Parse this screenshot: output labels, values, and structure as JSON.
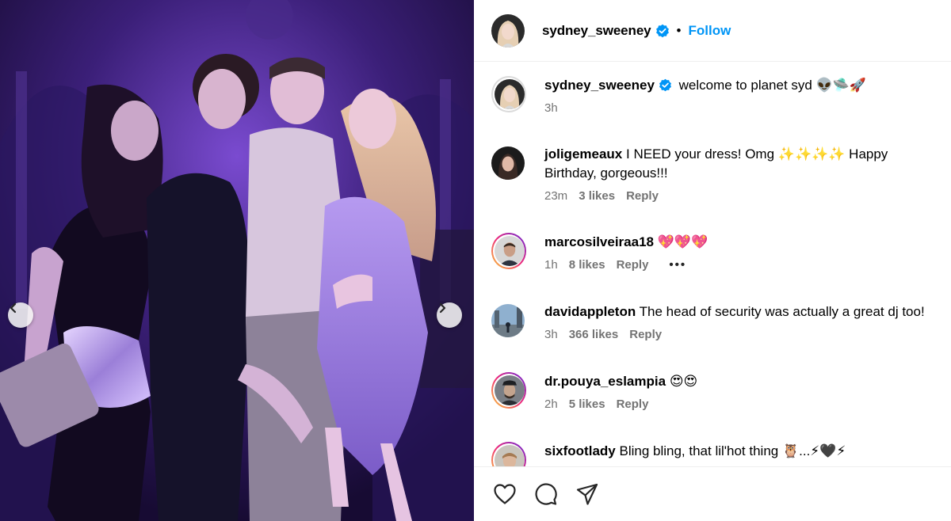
{
  "post": {
    "author": "sydney_sweeney",
    "follow_label": "Follow",
    "separator": "•"
  },
  "caption": {
    "username": "sydney_sweeney",
    "text": "welcome to planet syd 👽🛸🚀",
    "time": "3h"
  },
  "comments": [
    {
      "username": "joligemeaux",
      "text": "I NEED your dress! Omg ✨✨✨✨ Happy Birthday, gorgeous!!!",
      "time": "23m",
      "likes": "3 likes",
      "reply": "Reply"
    },
    {
      "username": "marcosilveiraa18",
      "text": "💖💖💖",
      "time": "1h",
      "likes": "8 likes",
      "reply": "Reply",
      "more": "•••"
    },
    {
      "username": "davidappleton",
      "text": "The head of security was actually a great dj too!",
      "time": "3h",
      "likes": "366 likes",
      "reply": "Reply"
    },
    {
      "username": "dr.pouya_eslampia",
      "text": "😍😍",
      "time": "2h",
      "likes": "5 likes",
      "reply": "Reply"
    },
    {
      "username": "sixfootlady",
      "text": "Bling bling, that lil'hot thing 🦉...⚡🖤⚡",
      "time": "",
      "likes": "",
      "reply": ""
    }
  ],
  "icons": {
    "like": "heart-icon",
    "comment": "comment-icon",
    "share": "share-icon",
    "prev": "chevron-left-icon",
    "next": "chevron-right-icon",
    "verified": "verified-badge-icon"
  },
  "colors": {
    "accent": "#0095f6",
    "muted": "#737373",
    "verified": "#0095f6"
  }
}
